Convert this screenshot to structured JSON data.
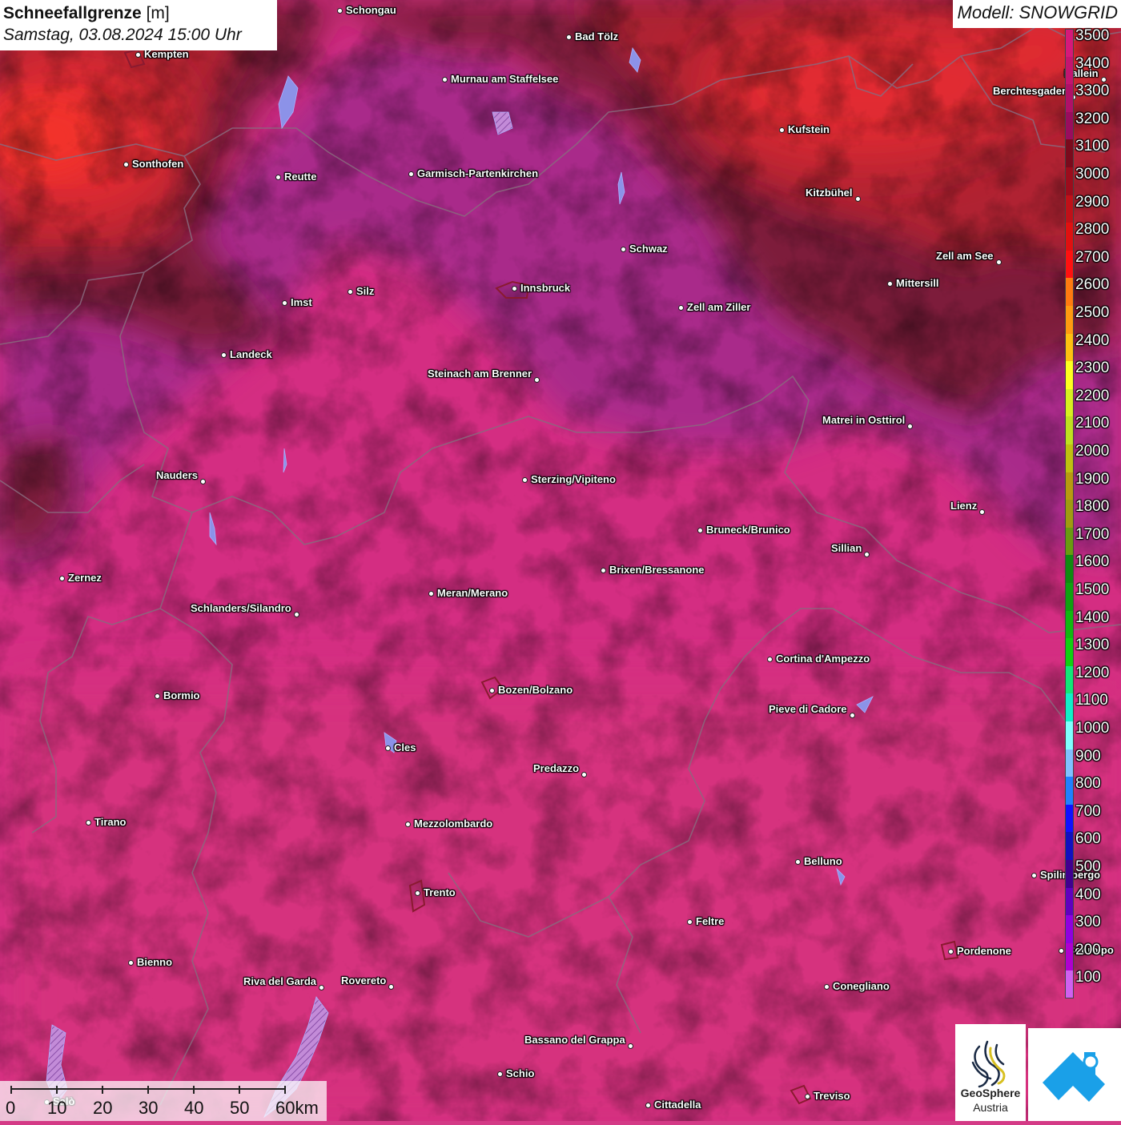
{
  "header": {
    "title_bold": "Schneefallgrenze",
    "title_unit": " [m]",
    "datetime": "Samstag, 03.08.2024 15:00 Uhr",
    "model": "Modell: SNOWGRID"
  },
  "legend": {
    "labels": [
      "3500",
      "3400",
      "3300",
      "3200",
      "3100",
      "3000",
      "2900",
      "2800",
      "2700",
      "2600",
      "2500",
      "2400",
      "2300",
      "2200",
      "2100",
      "2000",
      "1900",
      "1800",
      "1700",
      "1600",
      "1500",
      "1400",
      "1300",
      "1200",
      "1100",
      "1000",
      "900",
      "800",
      "700",
      "600",
      "500",
      "400",
      "300",
      "200",
      "100"
    ],
    "colors": [
      "#d6187a",
      "#c41470",
      "#b01068",
      "#9a0c5e",
      "#7a0a1c",
      "#9c0c1c",
      "#c01018",
      "#e01010",
      "#ff1010",
      "#ff7a10",
      "#ff9a10",
      "#ffc010",
      "#ffff20",
      "#d8f020",
      "#c0e020",
      "#c0c010",
      "#b89a10",
      "#a09a10",
      "#6a9a10",
      "#108a10",
      "#10a010",
      "#10b810",
      "#10d010",
      "#10e878",
      "#10f0c8",
      "#80ffff",
      "#80c0ff",
      "#2080ff",
      "#1010ff",
      "#1010c0",
      "#400090",
      "#6000c0",
      "#9000e0",
      "#b000d0",
      "#d060f0"
    ]
  },
  "cities": [
    {
      "name": "Schongau",
      "label_side": "right"
    },
    {
      "name": "Bad Tölz",
      "label_side": "right"
    },
    {
      "name": "Kempten",
      "label_side": "right"
    },
    {
      "name": "Murnau am Staffelsee",
      "label_side": "right"
    },
    {
      "name": "Hallein",
      "label_side": "left"
    },
    {
      "name": "Berchtesgaden",
      "label_side": "left"
    },
    {
      "name": "Kufstein",
      "label_side": "right"
    },
    {
      "name": "Sonthofen",
      "label_side": "right"
    },
    {
      "name": "Reutte",
      "label_side": "right"
    },
    {
      "name": "Garmisch-Partenkirchen",
      "label_side": "right"
    },
    {
      "name": "Kitzbühel",
      "label_side": "left"
    },
    {
      "name": "Schwaz",
      "label_side": "right"
    },
    {
      "name": "Zell am See",
      "label_side": "left"
    },
    {
      "name": "Innsbruck",
      "label_side": "right"
    },
    {
      "name": "Mittersill",
      "label_side": "right"
    },
    {
      "name": "Silz",
      "label_side": "right"
    },
    {
      "name": "Imst",
      "label_side": "right"
    },
    {
      "name": "Zell am Ziller",
      "label_side": "right"
    },
    {
      "name": "Landeck",
      "label_side": "right"
    },
    {
      "name": "Steinach am Brenner",
      "label_side": "left"
    },
    {
      "name": "Matrei in Osttirol",
      "label_side": "left"
    },
    {
      "name": "Nauders",
      "label_side": "left"
    },
    {
      "name": "Sterzing/Vipiteno",
      "label_side": "right"
    },
    {
      "name": "Lienz",
      "label_side": "left"
    },
    {
      "name": "Bruneck/Brunico",
      "label_side": "right"
    },
    {
      "name": "Sillian",
      "label_side": "left"
    },
    {
      "name": "Zernez",
      "label_side": "right"
    },
    {
      "name": "Brixen/Bressanone",
      "label_side": "right"
    },
    {
      "name": "Meran/Merano",
      "label_side": "right"
    },
    {
      "name": "Schlanders/Silandro",
      "label_side": "left"
    },
    {
      "name": "Cortina d'Ampezzo",
      "label_side": "right"
    },
    {
      "name": "Bozen/Bolzano",
      "label_side": "right"
    },
    {
      "name": "Bormio",
      "label_side": "right"
    },
    {
      "name": "Pieve di Cadore",
      "label_side": "left"
    },
    {
      "name": "Cles",
      "label_side": "right"
    },
    {
      "name": "Predazzo",
      "label_side": "left"
    },
    {
      "name": "Tirano",
      "label_side": "right"
    },
    {
      "name": "Mezzolombardo",
      "label_side": "right"
    },
    {
      "name": "Belluno",
      "label_side": "right"
    },
    {
      "name": "Spilimbergo",
      "label_side": "right"
    },
    {
      "name": "Trento",
      "label_side": "right"
    },
    {
      "name": "Feltre",
      "label_side": "right"
    },
    {
      "name": "Pordenone",
      "label_side": "right"
    },
    {
      "name": "Codroipo",
      "label_side": "right"
    },
    {
      "name": "Bienno",
      "label_side": "right"
    },
    {
      "name": "Riva del Garda",
      "label_side": "left"
    },
    {
      "name": "Rovereto",
      "label_side": "left"
    },
    {
      "name": "Conegliano",
      "label_side": "right"
    },
    {
      "name": "Bassano del Grappa",
      "label_side": "left"
    },
    {
      "name": "Schio",
      "label_side": "right"
    },
    {
      "name": "Treviso",
      "label_side": "right"
    },
    {
      "name": "Cittadella",
      "label_side": "right"
    },
    {
      "name": "Salò",
      "label_side": "right"
    }
  ],
  "scale_bar": {
    "ticks": [
      "0",
      "10",
      "20",
      "30",
      "40",
      "50",
      "60km"
    ]
  },
  "logos": {
    "geosphere_line1": "GeoSphere",
    "geosphere_line2": "Austria"
  }
}
